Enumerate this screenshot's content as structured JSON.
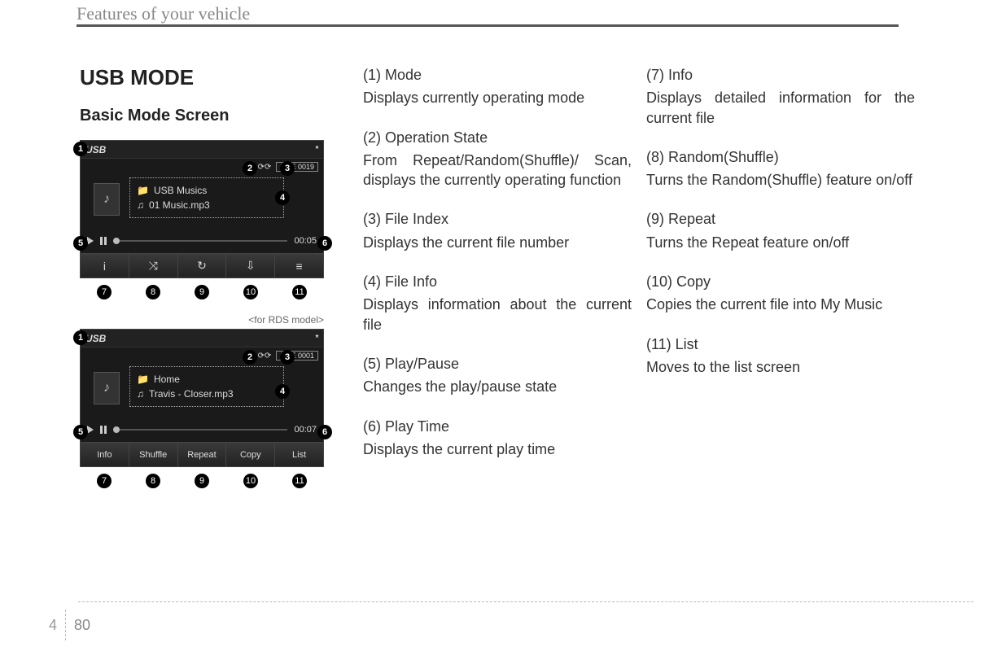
{
  "header": {
    "running_head": "Features of your vehicle"
  },
  "section": {
    "title": "USB MODE",
    "subtitle": "Basic Mode Screen",
    "rds_caption": "<for RDS model>"
  },
  "screenshot1": {
    "mode_label": "USB",
    "file_label": "FILE",
    "file_index": "0019",
    "folder": "USB Musics",
    "track": "01 Music.mp3",
    "play_time": "00:05",
    "softkeys_icons": [
      "i",
      "⤨",
      "↻",
      "⇩",
      "≡"
    ]
  },
  "screenshot2": {
    "mode_label": "USB",
    "file_label": "FILE",
    "file_index": "0001",
    "folder": "Home",
    "track": "Travis - Closer.mp3",
    "play_time": "00:07",
    "softkeys": [
      "Info",
      "Shuffle",
      "Repeat",
      "Copy",
      "List"
    ]
  },
  "callouts": {
    "n1": "1",
    "n2": "2",
    "n3": "3",
    "n4": "4",
    "n5": "5",
    "n6": "6",
    "n7": "7",
    "n8": "8",
    "n9": "9",
    "n10": "10",
    "n11": "11"
  },
  "items_left": [
    {
      "head": "(1) Mode",
      "body": "Displays currently operating mode"
    },
    {
      "head": "(2) Operation State",
      "body": "From Repeat/Random(Shuffle)/ Scan, displays the currently operating function"
    },
    {
      "head": "(3) File Index",
      "body": "Displays the current file number"
    },
    {
      "head": "(4) File Info",
      "body": "Displays information about the current file"
    },
    {
      "head": "(5) Play/Pause",
      "body": "Changes the play/pause state"
    },
    {
      "head": "(6) Play Time",
      "body": "Displays the current play time"
    }
  ],
  "items_right": [
    {
      "head": "(7) Info",
      "body": "Displays detailed information for the current file"
    },
    {
      "head": "(8) Random(Shuffle)",
      "body": "Turns the Random(Shuffle) feature on/off"
    },
    {
      "head": "(9) Repeat",
      "body": "Turns the Repeat feature on/off"
    },
    {
      "head": "(10) Copy",
      "body": "Copies the current file into My Music"
    },
    {
      "head": "(11) List",
      "body": "Moves to the list screen"
    }
  ],
  "footer": {
    "chapter": "4",
    "page": "80"
  }
}
